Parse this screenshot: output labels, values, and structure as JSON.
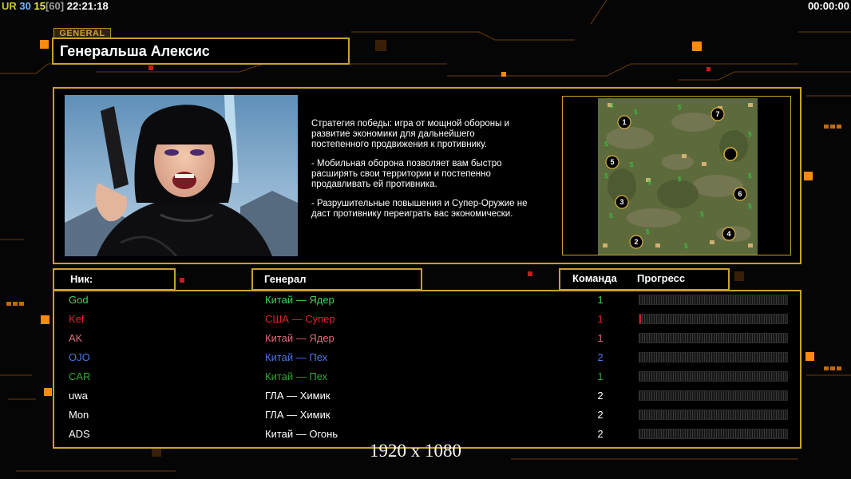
{
  "hud": {
    "left_ur": "UR",
    "fps_a": "30",
    "fps_b": "15",
    "fps_c": "[60]",
    "clock": "22:21:18",
    "timer": "00:00:00"
  },
  "general": {
    "tag": "GENERAL",
    "name": "Генеральша Алексис",
    "portrait_icon": "general-alexis-portrait"
  },
  "strategy": [
    "Стратегия победы: игра от мощной обороны и\n развитие экономики для дальнейшего\n постепенного продвижения к противнику.",
    "- Мобильная оборона позволяет вам быстро\n расширять свои территории и постепенно\n продавливать ей противника.",
    "- Разрушительные повышения и Супер-Оружие не\n даст противнику переиграть вас экономически."
  ],
  "minimap": {
    "start_positions": [
      "1",
      "7",
      "5",
      "3",
      "6",
      "2",
      "4"
    ]
  },
  "columns": {
    "nick": "Ник:",
    "general": "Генерал",
    "team": "Команда",
    "progress": "Прогресс"
  },
  "players": [
    {
      "nick": "God",
      "general": "Китай — Ядер",
      "team": "1",
      "color": "#3fd35a",
      "progress": 0
    },
    {
      "nick": "Kef",
      "general": "США — Супер",
      "team": "1",
      "color": "#e8202a",
      "progress": 0.01
    },
    {
      "nick": "AK",
      "general": "Китай — Ядер",
      "team": "1",
      "color": "#e06a7a",
      "progress": 0
    },
    {
      "nick": "OJO",
      "general": "Китай — Пех",
      "team": "2",
      "color": "#4a78e8",
      "progress": 0
    },
    {
      "nick": "CAR",
      "general": "Китай — Пех",
      "team": "1",
      "color": "#2fa830",
      "progress": 0
    },
    {
      "nick": "uwa",
      "general": "ГЛА — Химик",
      "team": "2",
      "color": "#ffffff",
      "progress": 0
    },
    {
      "nick": "Mon",
      "general": "ГЛА — Химик",
      "team": "2",
      "color": "#ffffff",
      "progress": 0
    },
    {
      "nick": "ADS",
      "general": "Китай — Огонь",
      "team": "2",
      "color": "#ffffff",
      "progress": 0
    }
  ],
  "resolution": "1920 x 1080"
}
